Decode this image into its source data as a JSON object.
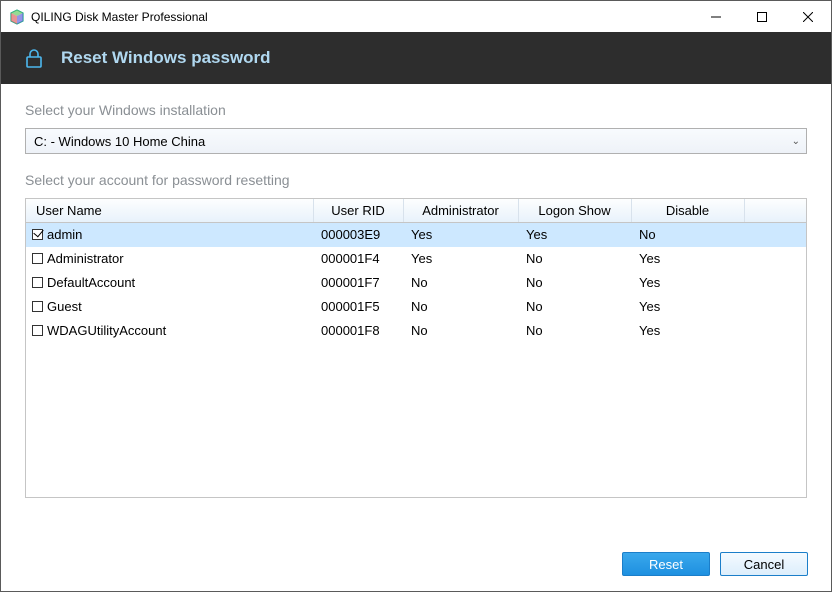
{
  "window": {
    "title": "QILING Disk Master Professional"
  },
  "header": {
    "title": "Reset Windows password"
  },
  "labels": {
    "select_install": "Select your Windows installation",
    "select_account": "Select your account for password resetting"
  },
  "dropdown": {
    "selected": "C: - Windows 10 Home China"
  },
  "table": {
    "columns": {
      "name": "User Name",
      "rid": "User RID",
      "admin": "Administrator",
      "logon": "Logon Show",
      "disable": "Disable"
    },
    "rows": [
      {
        "checked": true,
        "name": "admin",
        "rid": "000003E9",
        "admin": "Yes",
        "logon": "Yes",
        "disable": "No",
        "selected": true
      },
      {
        "checked": false,
        "name": "Administrator",
        "rid": "000001F4",
        "admin": "Yes",
        "logon": "No",
        "disable": "Yes",
        "selected": false
      },
      {
        "checked": false,
        "name": "DefaultAccount",
        "rid": "000001F7",
        "admin": "No",
        "logon": "No",
        "disable": "Yes",
        "selected": false
      },
      {
        "checked": false,
        "name": "Guest",
        "rid": "000001F5",
        "admin": "No",
        "logon": "No",
        "disable": "Yes",
        "selected": false
      },
      {
        "checked": false,
        "name": "WDAGUtilityAccount",
        "rid": "000001F8",
        "admin": "No",
        "logon": "No",
        "disable": "Yes",
        "selected": false
      }
    ]
  },
  "buttons": {
    "reset": "Reset",
    "cancel": "Cancel"
  }
}
